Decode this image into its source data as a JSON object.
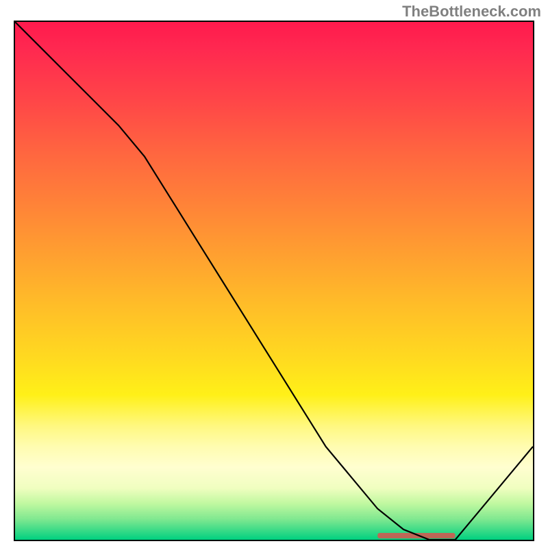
{
  "watermark": {
    "text": "TheBottleneck.com"
  },
  "colors": {
    "curve": "#000000",
    "highlight": "#d9534f",
    "border": "#000000"
  },
  "chart_data": {
    "type": "line",
    "title": "",
    "xlabel": "",
    "ylabel": "",
    "xlim": [
      0,
      100
    ],
    "ylim": [
      0,
      100
    ],
    "x": [
      0,
      5,
      10,
      15,
      20,
      25,
      30,
      35,
      40,
      45,
      50,
      55,
      60,
      65,
      70,
      75,
      80,
      82,
      85,
      90,
      95,
      100
    ],
    "values": [
      100,
      95,
      90,
      85,
      80,
      74,
      66,
      58,
      50,
      42,
      34,
      26,
      18,
      12,
      6,
      2,
      0,
      0,
      0,
      6,
      12,
      18
    ],
    "highlight_range": {
      "x_start": 70,
      "x_end": 85,
      "y": 0
    },
    "grid": false,
    "legend": false,
    "annotations": []
  }
}
